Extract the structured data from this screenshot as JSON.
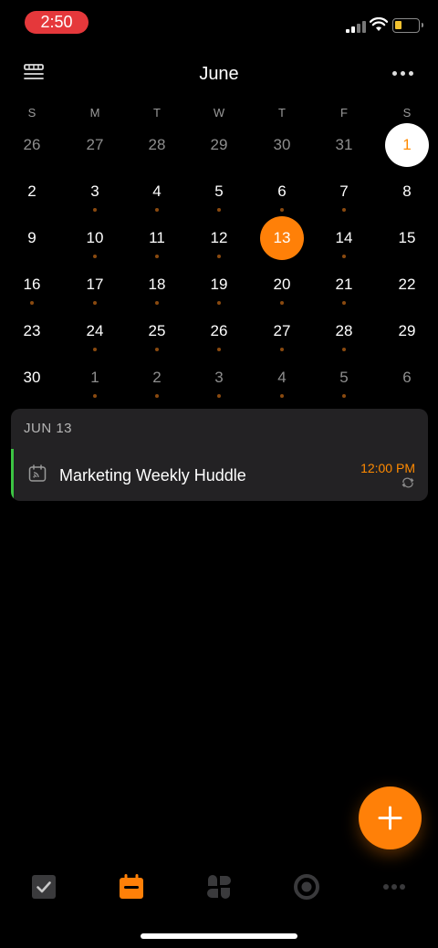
{
  "status_bar": {
    "time": "2:50",
    "time_pill_color": "#e5383b",
    "battery_color": "#f2c230"
  },
  "header": {
    "title": "June",
    "menu_icon": "list-view-icon",
    "more_icon": "more-horizontal-icon"
  },
  "weekdays": [
    "S",
    "M",
    "T",
    "W",
    "T",
    "F",
    "S"
  ],
  "weeks": [
    [
      {
        "d": "26",
        "muted": true
      },
      {
        "d": "27",
        "muted": true
      },
      {
        "d": "28",
        "muted": true
      },
      {
        "d": "29",
        "muted": true
      },
      {
        "d": "30",
        "muted": true
      },
      {
        "d": "31",
        "muted": true
      },
      {
        "d": "1",
        "today": true
      }
    ],
    [
      {
        "d": "2"
      },
      {
        "d": "3",
        "dot": true
      },
      {
        "d": "4",
        "dot": true
      },
      {
        "d": "5",
        "dot": true
      },
      {
        "d": "6",
        "dot": true
      },
      {
        "d": "7",
        "dot": true
      },
      {
        "d": "8"
      }
    ],
    [
      {
        "d": "9"
      },
      {
        "d": "10",
        "dot": true
      },
      {
        "d": "11",
        "dot": true
      },
      {
        "d": "12",
        "dot": true
      },
      {
        "d": "13",
        "selected": true
      },
      {
        "d": "14",
        "dot": true
      },
      {
        "d": "15"
      }
    ],
    [
      {
        "d": "16",
        "dot": true
      },
      {
        "d": "17",
        "dot": true
      },
      {
        "d": "18",
        "dot": true
      },
      {
        "d": "19",
        "dot": true
      },
      {
        "d": "20",
        "dot": true
      },
      {
        "d": "21",
        "dot": true
      },
      {
        "d": "22"
      }
    ],
    [
      {
        "d": "23"
      },
      {
        "d": "24",
        "dot": true
      },
      {
        "d": "25",
        "dot": true
      },
      {
        "d": "26",
        "dot": true
      },
      {
        "d": "27",
        "dot": true
      },
      {
        "d": "28",
        "dot": true
      },
      {
        "d": "29"
      }
    ],
    [
      {
        "d": "30"
      },
      {
        "d": "1",
        "muted": true,
        "dot": true
      },
      {
        "d": "2",
        "muted": true,
        "dot": true
      },
      {
        "d": "3",
        "muted": true,
        "dot": true
      },
      {
        "d": "4",
        "muted": true,
        "dot": true
      },
      {
        "d": "5",
        "muted": true,
        "dot": true
      },
      {
        "d": "6",
        "muted": true
      }
    ]
  ],
  "agenda": {
    "date_label": "JUN 13",
    "events": [
      {
        "title": "Marketing Weekly Huddle",
        "time": "12:00 PM",
        "icon": "calendar-feed-icon",
        "repeat_icon": "repeat-icon",
        "accent_color": "#3cc443"
      }
    ]
  },
  "fab": {
    "icon": "plus-icon",
    "color": "#ff8008"
  },
  "tabbar": {
    "tabs": [
      {
        "name": "tasks",
        "icon": "checkbox-icon",
        "active": false
      },
      {
        "name": "calendar",
        "icon": "calendar-icon",
        "active": true
      },
      {
        "name": "matrix",
        "icon": "grid-clover-icon",
        "active": false
      },
      {
        "name": "focus",
        "icon": "target-icon",
        "active": false
      },
      {
        "name": "more",
        "icon": "more-horizontal-icon",
        "active": false
      }
    ]
  },
  "accent_color": "#ff8008"
}
